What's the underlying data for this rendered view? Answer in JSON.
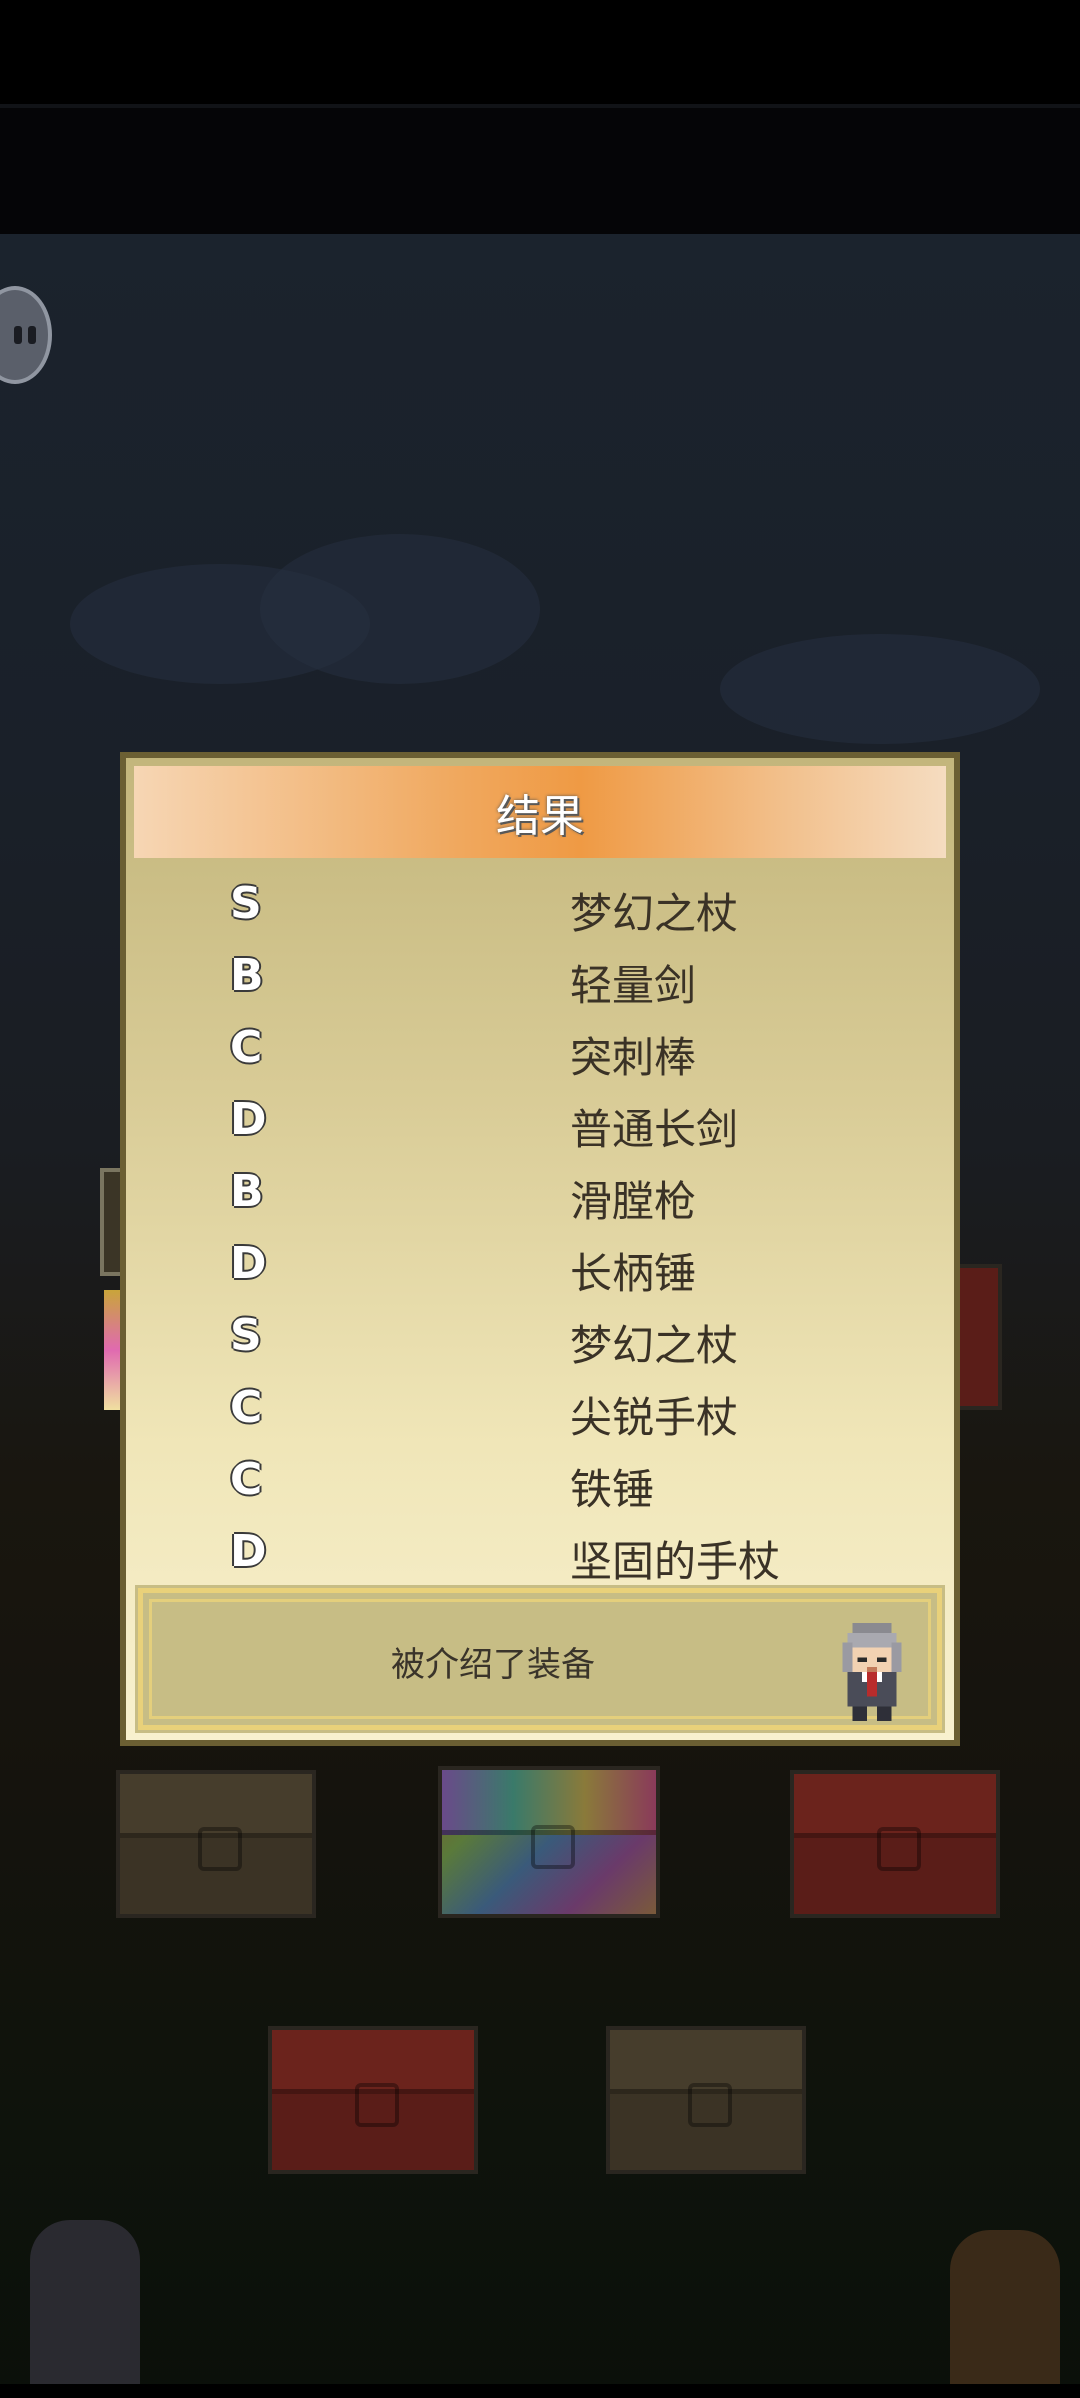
{
  "dialog": {
    "title": "结果",
    "results": [
      {
        "rank": "S",
        "item": "梦幻之杖"
      },
      {
        "rank": "B",
        "item": "轻量剑"
      },
      {
        "rank": "C",
        "item": "突刺棒"
      },
      {
        "rank": "D",
        "item": "普通长剑"
      },
      {
        "rank": "B",
        "item": "滑膛枪"
      },
      {
        "rank": "D",
        "item": "长柄锤"
      },
      {
        "rank": "S",
        "item": "梦幻之杖"
      },
      {
        "rank": "C",
        "item": "尖锐手杖"
      },
      {
        "rank": "C",
        "item": "铁锤"
      },
      {
        "rank": "D",
        "item": "坚固的手杖"
      }
    ],
    "message": "被介绍了装备"
  },
  "colors": {
    "title_bar": "#ef9a44",
    "dialog_border": "#6b5f33",
    "dialog_bg": "#f0e6b8",
    "message_box": "#c7bd85"
  },
  "icons": {
    "pause": "pause-icon",
    "npc": "elder-npc-sprite"
  }
}
